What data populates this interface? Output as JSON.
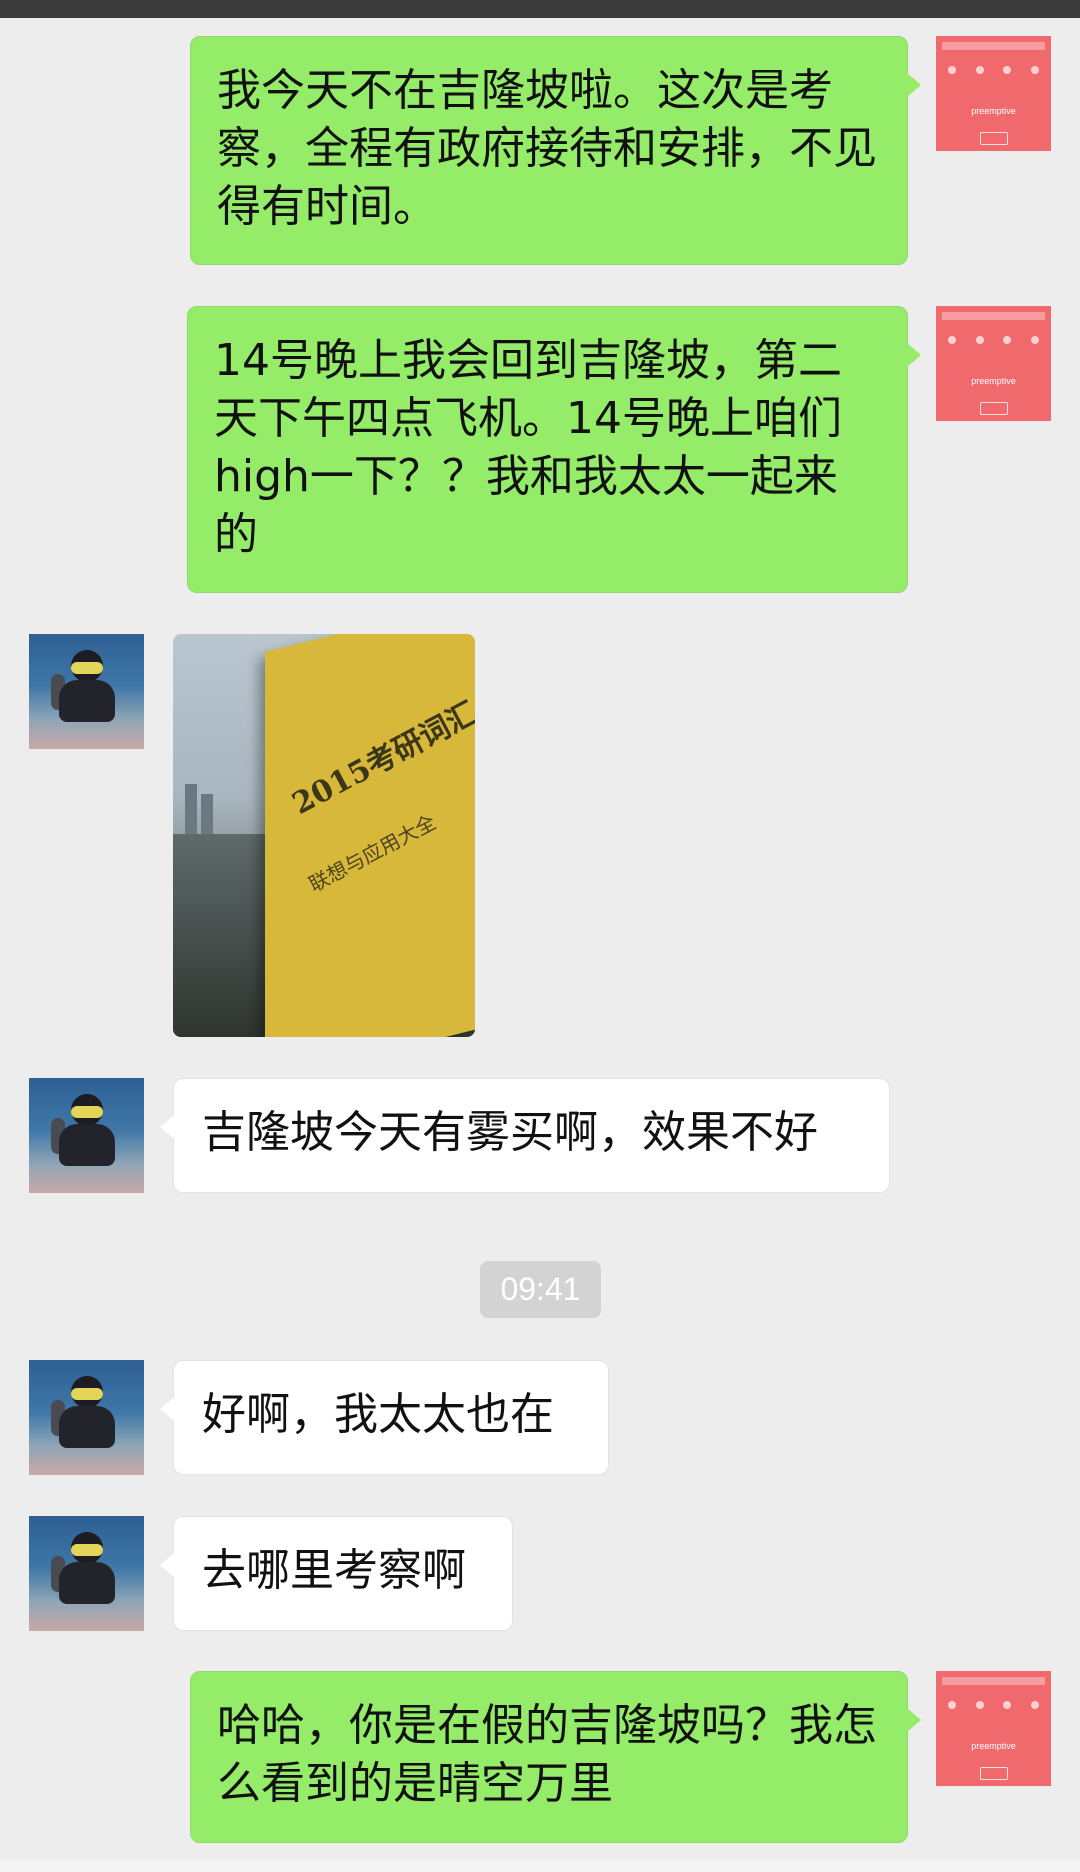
{
  "messages": [
    {
      "sender": "me",
      "text": "我今天不在吉隆坡啦。这次是考察，全程有政府接待和安排，不见得有时间。"
    },
    {
      "sender": "me",
      "text": "14号晚上我会回到吉隆坡，第二天下午四点飞机。14号晚上咱们high一下？？我和我太太一起来的"
    },
    {
      "sender": "friend",
      "type": "image",
      "image": {
        "title": "2015考研词汇",
        "subtitle": "联想与应用大全"
      }
    },
    {
      "sender": "friend",
      "text": "吉隆坡今天有雾买啊，效果不好"
    },
    {
      "sender": "friend",
      "text": "好啊，我太太也在"
    },
    {
      "sender": "friend",
      "text": "去哪里考察啊"
    },
    {
      "sender": "me",
      "text": "哈哈，你是在假的吉隆坡吗？我怎么看到的是晴空万里"
    }
  ],
  "timestamp": "09:41",
  "my_avatar": {
    "icon": "phone-screenshot-avatar",
    "caption": "preemptive",
    "color": "#f0696d"
  },
  "friend_avatar": {
    "icon": "diver-avatar"
  },
  "colors": {
    "outgoing": "#95ec69",
    "incoming": "#ffffff",
    "background": "#ededed"
  }
}
